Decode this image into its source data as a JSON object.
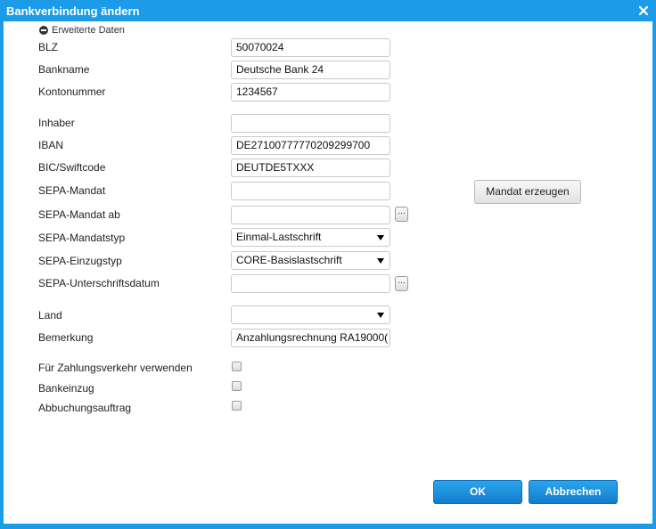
{
  "dialog": {
    "title": "Bankverbindung ändern",
    "close_icon": "close-icon"
  },
  "advanced_toggle": {
    "label": "Erweiterte Daten",
    "icon": "minus-circle-icon"
  },
  "fields": {
    "blz": {
      "label": "BLZ",
      "value": "50070024"
    },
    "bankname": {
      "label": "Bankname",
      "value": "Deutsche Bank 24"
    },
    "kontonummer": {
      "label": "Kontonummer",
      "value": "1234567"
    },
    "inhaber": {
      "label": "Inhaber",
      "value": ""
    },
    "iban": {
      "label": "IBAN",
      "value": "DE27100777770209299700"
    },
    "bic": {
      "label": "BIC/Swiftcode",
      "value": "DEUTDE5TXXX"
    },
    "sepa_mandat": {
      "label": "SEPA-Mandat",
      "value": ""
    },
    "sepa_mandat_ab": {
      "label": "SEPA-Mandat ab",
      "value": "",
      "button": "..."
    },
    "sepa_mandatstyp": {
      "label": "SEPA-Mandatstyp",
      "value": "Einmal-Lastschrift"
    },
    "sepa_einzugstyp": {
      "label": "SEPA-Einzugstyp",
      "value": "CORE-Basislastschrift"
    },
    "sepa_unterschriftsdatum": {
      "label": "SEPA-Unterschriftsdatum",
      "value": "",
      "button": "..."
    },
    "land": {
      "label": "Land",
      "value": ""
    },
    "bemerkung": {
      "label": "Bemerkung",
      "value": "Anzahlungsrechnung RA19000("
    }
  },
  "checkboxes": {
    "zahlungsverkehr": {
      "label": "Für Zahlungsverkehr verwenden",
      "checked": false
    },
    "bankeinzug": {
      "label": "Bankeinzug",
      "checked": false
    },
    "abbuchungsauftrag": {
      "label": "Abbuchungsauftrag",
      "checked": false
    }
  },
  "buttons": {
    "mandat_erzeugen": "Mandat erzeugen",
    "ok": "OK",
    "abbrechen": "Abbrechen"
  },
  "colors": {
    "accent": "#1b9be8",
    "button_primary": "#1a8fe0"
  }
}
